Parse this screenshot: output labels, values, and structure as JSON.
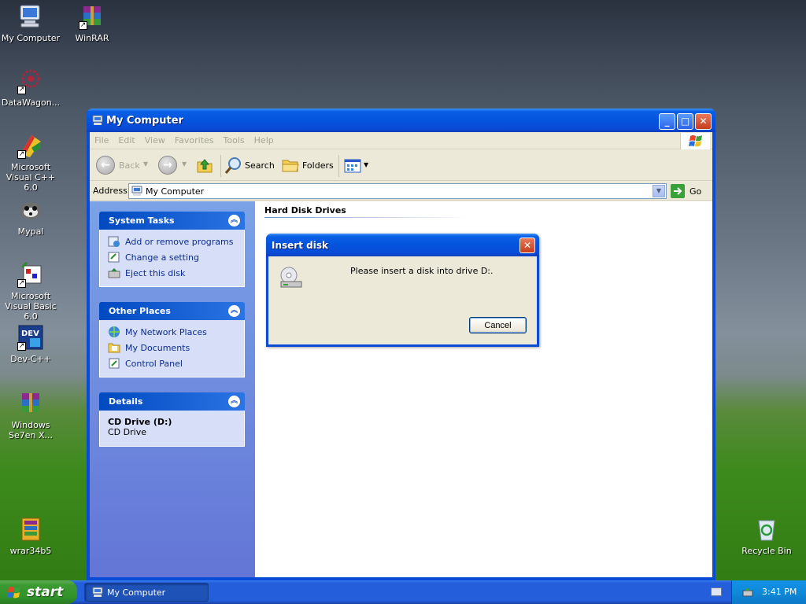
{
  "desktop": {
    "icons": [
      {
        "label": "My Computer"
      },
      {
        "label": "WinRAR"
      },
      {
        "label": "DataWagon..."
      },
      {
        "label": "Microsoft Visual C++ 6.0"
      },
      {
        "label": "Mypal"
      },
      {
        "label": "Microsoft Visual Basic 6.0"
      },
      {
        "label": "Dev-C++"
      },
      {
        "label": "Windows Se7en X..."
      },
      {
        "label": "wrar34b5"
      },
      {
        "label": "Recycle Bin"
      }
    ]
  },
  "window": {
    "title": "My Computer",
    "menu": [
      "File",
      "Edit",
      "View",
      "Favorites",
      "Tools",
      "Help"
    ],
    "toolbar": {
      "back": "Back",
      "search": "Search",
      "folders": "Folders"
    },
    "address": {
      "label": "Address",
      "value": "My Computer",
      "go": "Go"
    },
    "taskpane": {
      "system_tasks": {
        "title": "System Tasks",
        "items": [
          "Add or remove programs",
          "Change a setting",
          "Eject this disk"
        ]
      },
      "other_places": {
        "title": "Other Places",
        "items": [
          "My Network Places",
          "My Documents",
          "Control Panel"
        ]
      },
      "details": {
        "title": "Details",
        "name": "CD Drive (D:)",
        "type": "CD Drive"
      }
    },
    "content": {
      "group_title": "Hard Disk Drives"
    }
  },
  "dialog": {
    "title": "Insert disk",
    "message": "Please insert a disk into drive D:.",
    "cancel": "Cancel"
  },
  "taskbar": {
    "start": "start",
    "task": "My Computer",
    "clock": "3:41 PM"
  },
  "colors": {
    "xp_blue": "#0a4bd6",
    "start_green": "#3c9a32",
    "taskpane_link": "#0c2c8c"
  }
}
